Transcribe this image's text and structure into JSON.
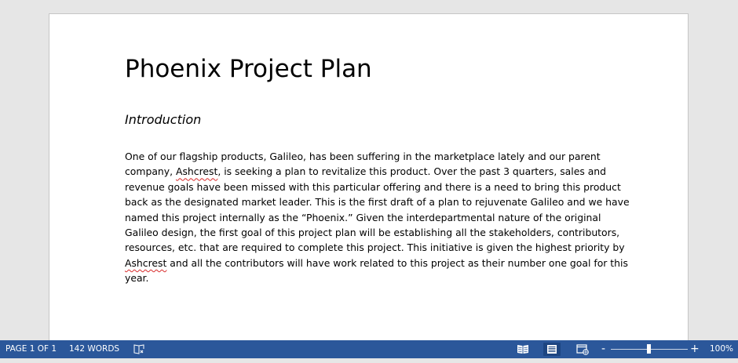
{
  "document": {
    "title": "Phoenix Project Plan",
    "heading": "Introduction",
    "body_lines": [
      [
        "One of our flagship products, Galileo, has been suffering in the marketplace lately and our parent"
      ],
      [
        "company, ",
        "Ashcrest",
        ", is seeking a plan to revitalize this product. Over the past 3 quarters, sales and"
      ],
      [
        "revenue goals have been missed with this particular offering and there is a need to bring this product"
      ],
      [
        "back as the designated market leader. This is the first draft of a plan to rejuvenate Galileo and we have"
      ],
      [
        "named this project internally as the “Phoenix.” Given the interdepartmental nature of the original"
      ],
      [
        "Galileo design, the first goal of this project plan will be establishing all the stakeholders, contributors,"
      ],
      [
        "resources, etc. that are required to complete this project. This initiative is given the highest priority by"
      ],
      [
        "",
        "Ashcrest",
        " and all the contributors will have work related to this project as their number one goal for this"
      ],
      [
        "year."
      ]
    ]
  },
  "statusbar": {
    "page_indicator": "PAGE 1 OF 1",
    "word_count": "142 WORDS",
    "zoom_percent": "100%",
    "zoom_minus": "-",
    "zoom_plus": "+",
    "zoom_level": 1.0,
    "active_view": "print-layout",
    "colors": {
      "background": "#2b579a",
      "text": "#ffffff"
    }
  },
  "icons": {
    "proofing": "proofing-book-icon",
    "read_mode": "read-mode-icon",
    "print_layout": "print-layout-icon",
    "web_layout": "web-layout-icon"
  }
}
